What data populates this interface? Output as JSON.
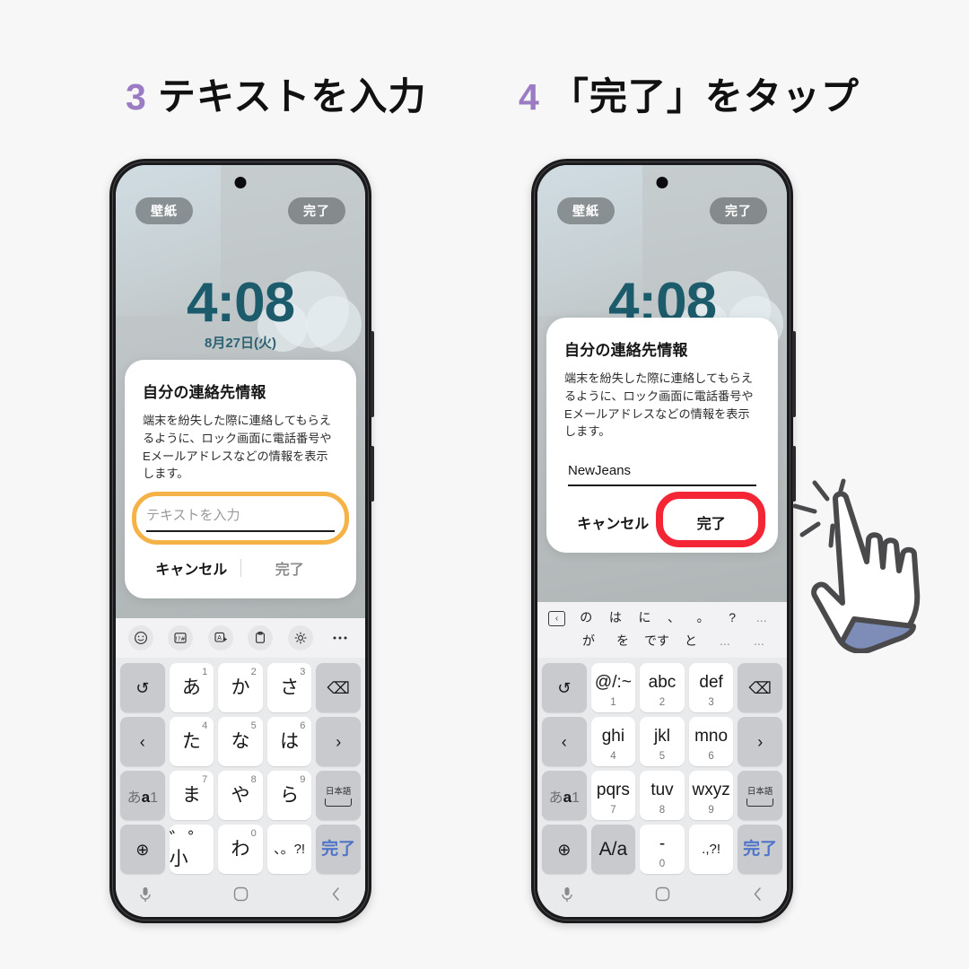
{
  "headings": [
    {
      "number": "3",
      "text": "テキストを入力"
    },
    {
      "number": "4",
      "text": "「完了」をタップ"
    }
  ],
  "colors": {
    "accent_number": "#9b7cc4",
    "highlight_orange": "#f5b246",
    "highlight_red": "#f42534",
    "clock_teal": "#1c5b6b",
    "key_blue": "#4f74c8"
  },
  "lockscreen": {
    "wallpaper_button": "壁紙",
    "done_button": "完了",
    "clock": "4:08",
    "date": "8月27日(火)"
  },
  "dialog": {
    "title": "自分の連絡先情報",
    "body": "端末を紛失した際に連絡してもらえるように、ロック画面に電話番号やEメールアドレスなどの情報を表示します。",
    "input_placeholder": "テキストを入力",
    "input_value": "NewJeans",
    "cancel_label": "キャンセル",
    "ok_label": "完了"
  },
  "keyboard_toolbar": [
    {
      "icon": "emoji-icon",
      "label": "☺"
    },
    {
      "icon": "symbols-icon",
      "label": "!?#"
    },
    {
      "icon": "translate-icon",
      "label": "A"
    },
    {
      "icon": "clipboard-icon",
      "label": "clipboard"
    },
    {
      "icon": "gear-icon",
      "label": "gear"
    },
    {
      "icon": "more-icon",
      "label": "•••"
    }
  ],
  "keyboard_jp": {
    "rows": [
      [
        {
          "name": "undo-key",
          "label": "↺",
          "type": "fn"
        },
        {
          "name": "key-a",
          "label": "あ",
          "num": "1",
          "type": "char"
        },
        {
          "name": "key-ka",
          "label": "か",
          "num": "2",
          "type": "char"
        },
        {
          "name": "key-sa",
          "label": "さ",
          "num": "3",
          "type": "char"
        },
        {
          "name": "backspace-key",
          "label": "⌫",
          "type": "fn"
        }
      ],
      [
        {
          "name": "cursor-left-key",
          "label": "‹",
          "type": "fn"
        },
        {
          "name": "key-ta",
          "label": "た",
          "num": "4",
          "type": "char"
        },
        {
          "name": "key-na",
          "label": "な",
          "num": "5",
          "type": "char"
        },
        {
          "name": "key-ha",
          "label": "は",
          "num": "6",
          "type": "char"
        },
        {
          "name": "cursor-right-key",
          "label": "›",
          "type": "fn"
        }
      ],
      [
        {
          "name": "input-mode-key",
          "label": "あa1",
          "type": "mode"
        },
        {
          "name": "key-ma",
          "label": "ま",
          "num": "7",
          "type": "char"
        },
        {
          "name": "key-ya",
          "label": "や",
          "num": "8",
          "type": "char"
        },
        {
          "name": "key-ra",
          "label": "ら",
          "num": "9",
          "type": "char"
        },
        {
          "name": "space-key",
          "label": "日本語",
          "type": "space"
        }
      ],
      [
        {
          "name": "language-key",
          "label": "⊕",
          "type": "fn"
        },
        {
          "name": "dakuten-key",
          "label": "゛゜小",
          "type": "char"
        },
        {
          "name": "key-wa",
          "label": "わ",
          "num": "0",
          "type": "char"
        },
        {
          "name": "punctuation-key",
          "label": "、。?!",
          "type": "char"
        },
        {
          "name": "enter-done-key",
          "label": "完了",
          "type": "done"
        }
      ]
    ]
  },
  "keyboard_en": {
    "suggestions_row1": [
      "の",
      "は",
      "に",
      "、",
      "。",
      "?",
      "..."
    ],
    "suggestions_row2": [
      "が",
      "を",
      "です",
      "と",
      "...",
      "..."
    ],
    "rows": [
      [
        {
          "name": "undo-key",
          "label": "↺",
          "type": "fn"
        },
        {
          "name": "key-symbols",
          "label": "@/:~",
          "num": "1",
          "type": "alpha"
        },
        {
          "name": "key-abc",
          "label": "abc",
          "num": "2",
          "type": "alpha"
        },
        {
          "name": "key-def",
          "label": "def",
          "num": "3",
          "type": "alpha"
        },
        {
          "name": "backspace-key",
          "label": "⌫",
          "type": "fn"
        }
      ],
      [
        {
          "name": "cursor-left-key",
          "label": "‹",
          "type": "fn"
        },
        {
          "name": "key-ghi",
          "label": "ghi",
          "num": "4",
          "type": "alpha"
        },
        {
          "name": "key-jkl",
          "label": "jkl",
          "num": "5",
          "type": "alpha"
        },
        {
          "name": "key-mno",
          "label": "mno",
          "num": "6",
          "type": "alpha"
        },
        {
          "name": "cursor-right-key",
          "label": "›",
          "type": "fn"
        }
      ],
      [
        {
          "name": "input-mode-key",
          "label": "あa1",
          "type": "mode"
        },
        {
          "name": "key-pqrs",
          "label": "pqrs",
          "num": "7",
          "type": "alpha"
        },
        {
          "name": "key-tuv",
          "label": "tuv",
          "num": "8",
          "type": "alpha"
        },
        {
          "name": "key-wxyz",
          "label": "wxyz",
          "num": "9",
          "type": "alpha"
        },
        {
          "name": "space-key",
          "label": "日本語",
          "type": "space"
        }
      ],
      [
        {
          "name": "language-key",
          "label": "⊕",
          "type": "fn"
        },
        {
          "name": "case-toggle-key",
          "label": "A/a",
          "type": "fn2"
        },
        {
          "name": "key-hyphen",
          "label": "-",
          "num": "0",
          "type": "alpha"
        },
        {
          "name": "punctuation-key",
          "label": ".,?!",
          "type": "char"
        },
        {
          "name": "enter-done-key",
          "label": "完了",
          "type": "done"
        }
      ]
    ]
  },
  "navbar": {
    "mic": "mic-icon",
    "home": "home-icon",
    "back": "back-icon"
  }
}
